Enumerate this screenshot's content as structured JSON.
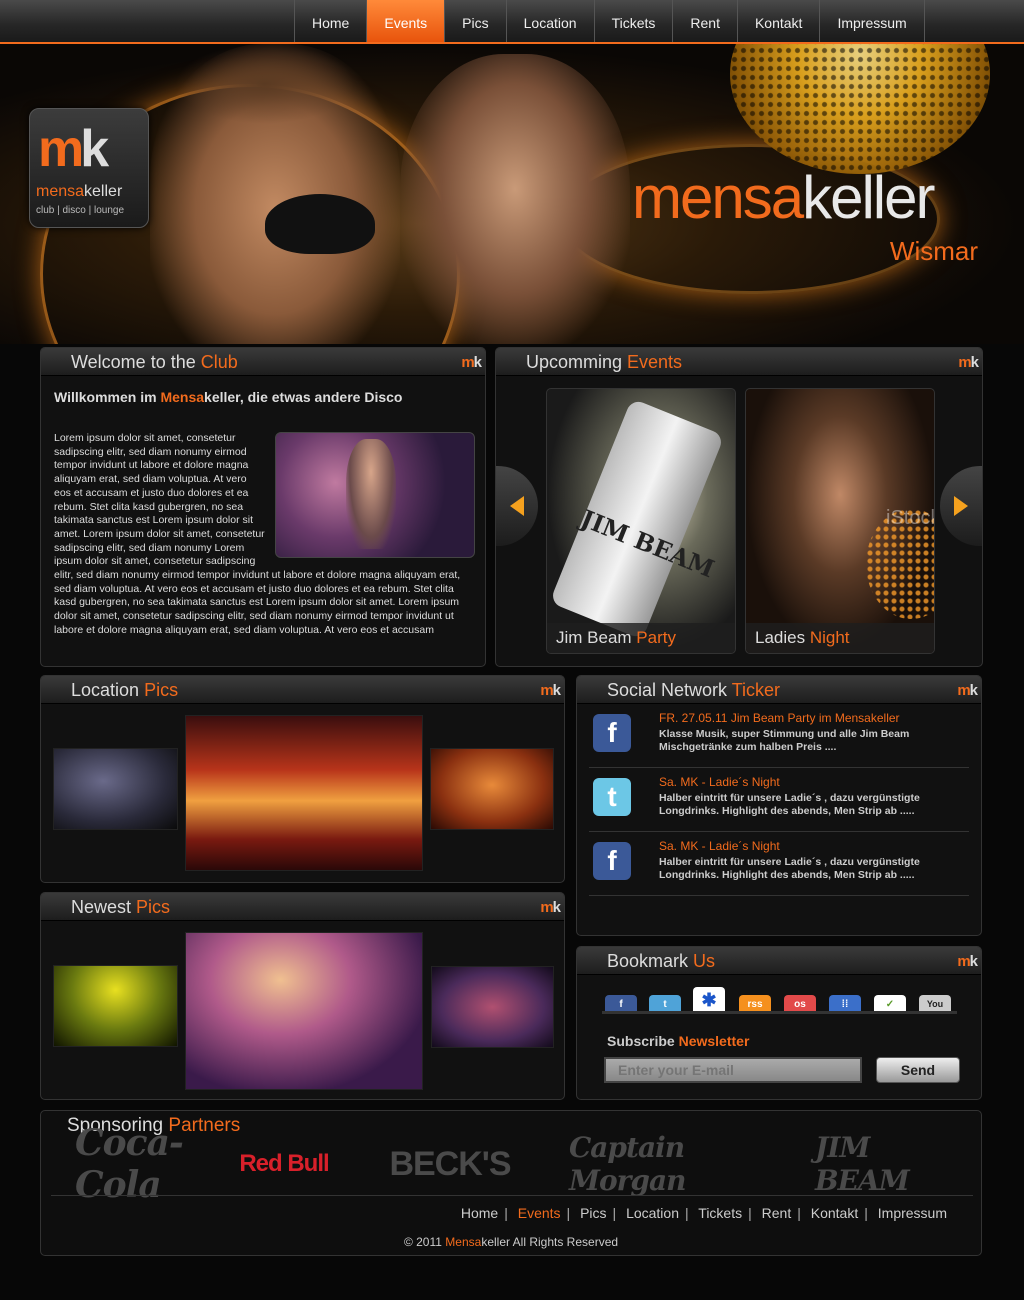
{
  "nav": {
    "items": [
      "Home",
      "Events",
      "Pics",
      "Location",
      "Tickets",
      "Rent",
      "Kontakt",
      "Impressum"
    ],
    "active": "Events"
  },
  "hero": {
    "logo_mark_m": "m",
    "logo_mark_k": "k",
    "logo_name_a": "mensa",
    "logo_name_b": "keller",
    "logo_tagline": "club | disco | lounge",
    "title_a": "mensa",
    "title_b": "keller",
    "city": "Wismar"
  },
  "panel_mark": {
    "m": "m",
    "k": "k"
  },
  "welcome": {
    "head_a": "Welcome to the ",
    "head_b": "Club",
    "heading_a": "Willkommen im ",
    "heading_b": "Mensa",
    "heading_c": "keller, die etwas andere Disco",
    "body": "Lorem ipsum dolor sit amet, consetetur sadipscing elitr, sed diam nonumy eirmod tempor invidunt ut labore et dolore magna aliquyam erat, sed diam voluptua. At vero eos et accusam et justo duo dolores et ea rebum. Stet clita kasd gubergren, no sea takimata sanctus est Lorem ipsum dolor sit amet. Lorem ipsum dolor sit amet, consetetur sadipscing elitr, sed diam nonumy Lorem ipsum dolor sit amet, consetetur sadipscing elitr, sed diam nonumy eirmod tempor invidunt ut labore et dolore magna aliquyam erat, sed diam voluptua. At vero eos et accusam et justo duo dolores et ea rebum. Stet clita kasd gubergren, no sea takimata sanctus est Lorem ipsum dolor sit amet. Lorem ipsum dolor sit amet, consetetur sadipscing elitr, sed diam nonumy eirmod tempor invidunt ut labore et dolore magna aliquyam erat, sed diam voluptua. At vero eos et accusam"
  },
  "events": {
    "head_a": "Upcomming ",
    "head_b": "Events",
    "cards": [
      {
        "title_a": "Jim Beam ",
        "title_b": "Party"
      },
      {
        "title_a": "Ladies ",
        "title_b": "Night"
      }
    ],
    "bottle_label": "JIM BEAM",
    "watermark": "iStockph"
  },
  "location_pics": {
    "head_a": "Location ",
    "head_b": "Pics"
  },
  "newest_pics": {
    "head_a": "Newest ",
    "head_b": "Pics"
  },
  "ticker": {
    "head_a": "Social Network ",
    "head_b": "Ticker",
    "items": [
      {
        "network": "f",
        "title": "FR. 27.05.11  Jim Beam Party im Mensakeller",
        "text": "Klasse Musik, super Stimmung und alle Jim Beam Mischgetränke zum halben Preis ...."
      },
      {
        "network": "t",
        "title": "Sa. MK - Ladie´s Night",
        "text": "Halber eintritt für unsere Ladie´s , dazu vergünstigte Longdrinks. Highlight des abends, Men Strip ab ....."
      },
      {
        "network": "f",
        "title": "Sa. MK - Ladie´s Night",
        "text": "Halber eintritt für unsere Ladie´s , dazu vergünstigte Longdrinks. Highlight des abends, Men Strip ab ....."
      }
    ]
  },
  "bookmark": {
    "head_a": "Bookmark ",
    "head_b": "Us",
    "icons": [
      "f",
      "t",
      "✱",
      "rss",
      "os",
      "⁞⁞",
      "✓",
      "You"
    ],
    "icon_colors": [
      "#3b5998",
      "#4fa3d8",
      "#ffffff",
      "#f5901e",
      "#e24a4a",
      "#3b6fc9",
      "#ffffff",
      "#cccccc"
    ],
    "newsletter_a": "Subscribe ",
    "newsletter_b": "Newsletter",
    "email_placeholder": "Enter your E-mail",
    "send_label": "Send"
  },
  "sponsors": {
    "title_a": "Sponsoring ",
    "title_b": "Partners",
    "logos": [
      "Coca-Cola",
      "Red Bull",
      "BECK'S",
      "Captain Morgan",
      "JIM BEAM"
    ]
  },
  "footer": {
    "nav": [
      "Home",
      "Events",
      "Pics",
      "Location",
      "Tickets",
      "Rent",
      "Kontakt",
      "Impressum"
    ],
    "active": "Events",
    "copyright_a": "© 2011 ",
    "copyright_b": "Mensa",
    "copyright_c": "keller All Rights Reserved"
  },
  "colors": {
    "accent": "#f26b1d",
    "background": "#070707"
  }
}
